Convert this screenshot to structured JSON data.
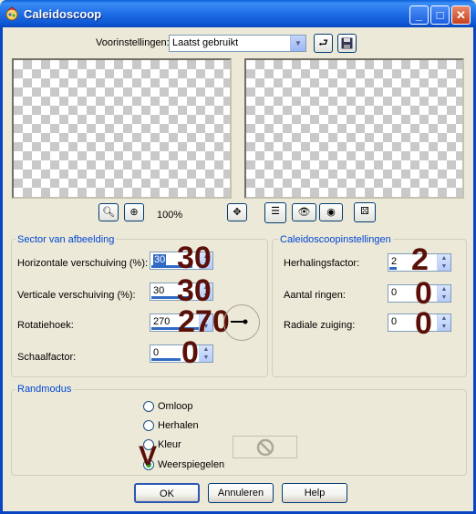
{
  "window": {
    "title": "Caleidoscoop",
    "min": "_",
    "max": "□",
    "close": "✕"
  },
  "presets": {
    "label": "Voorinstellingen:",
    "value": "Laatst gebruikt"
  },
  "preview": {
    "zoom": "100%"
  },
  "sector": {
    "title": "Sector van afbeelding",
    "fields": [
      {
        "label": "Horizontale verschuiving (%):",
        "value": "30",
        "big": "30"
      },
      {
        "label": "Verticale verschuiving (%):",
        "value": "30",
        "big": "30"
      },
      {
        "label": "Rotatiehoek:",
        "value": "270",
        "big": "270"
      },
      {
        "label": "Schaalfactor:",
        "value": "0",
        "big": "0"
      }
    ]
  },
  "kaleido": {
    "title": "Caleidoscoopinstellingen",
    "fields": [
      {
        "label": "Herhalingsfactor:",
        "value": "2",
        "big": "2"
      },
      {
        "label": "Aantal ringen:",
        "value": "0",
        "big": "0"
      },
      {
        "label": "Radiale zuiging:",
        "value": "0",
        "big": "0"
      }
    ]
  },
  "randmodus": {
    "title": "Randmodus",
    "options": [
      "Omloop",
      "Herhalen",
      "Kleur",
      "Weerspiegelen"
    ],
    "selected": "Weerspiegelen",
    "annotation": "V"
  },
  "buttons": {
    "ok": "OK",
    "cancel": "Annuleren",
    "help": "Help"
  },
  "colors": {
    "accent": "#0046d5",
    "annotation": "#5a1008"
  }
}
